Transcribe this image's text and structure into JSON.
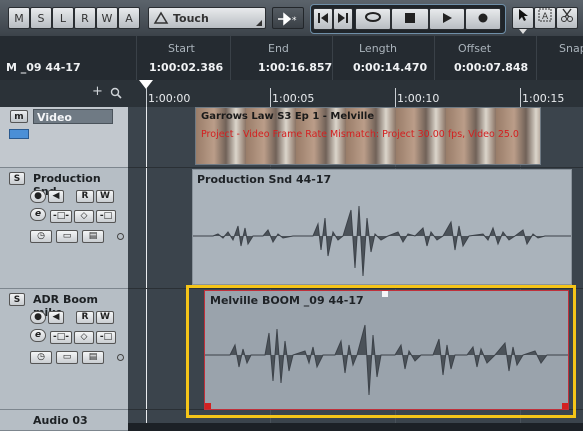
{
  "toolbar": {
    "mode_buttons": [
      "M",
      "S",
      "L",
      "R",
      "W",
      "A"
    ],
    "automation_mode": "Touch"
  },
  "info_line": {
    "event_name_partial": "M _09 44-17",
    "columns": [
      {
        "label": "Start",
        "value": "1:00:02.386"
      },
      {
        "label": "End",
        "value": "1:00:16.857"
      },
      {
        "label": "Length",
        "value": "0:00:14.470"
      },
      {
        "label": "Offset",
        "value": "0:00:07.848"
      },
      {
        "label": "Snap",
        "value": ""
      }
    ]
  },
  "ruler": {
    "ticks": [
      "1:00:00",
      "1:00:05",
      "1:00:10",
      "1:00:15"
    ]
  },
  "tracks": [
    {
      "name": "Video",
      "type": "video"
    },
    {
      "name": "Production Snd",
      "type": "audio"
    },
    {
      "name": "ADR Boom mike",
      "type": "audio"
    },
    {
      "name": "Audio 03",
      "type": "audio"
    }
  ],
  "track_buttons": {
    "solo": "S",
    "mute": "m",
    "read": "R",
    "write": "W",
    "edit": "e"
  },
  "events": {
    "video_title": "Garrows Law S3 Ep 1 - Melville",
    "video_warning": "Project - Video Frame Rate Mismatch: Project 30.00 fps, Video 25.0",
    "production_snd": "Production Snd 44-17",
    "adr_boom": "Melville BOOM _09 44-17"
  },
  "colors": {
    "highlight_frame": "#f5c518",
    "selected_event_border": "#c0303a",
    "warning_text": "#d42020"
  }
}
